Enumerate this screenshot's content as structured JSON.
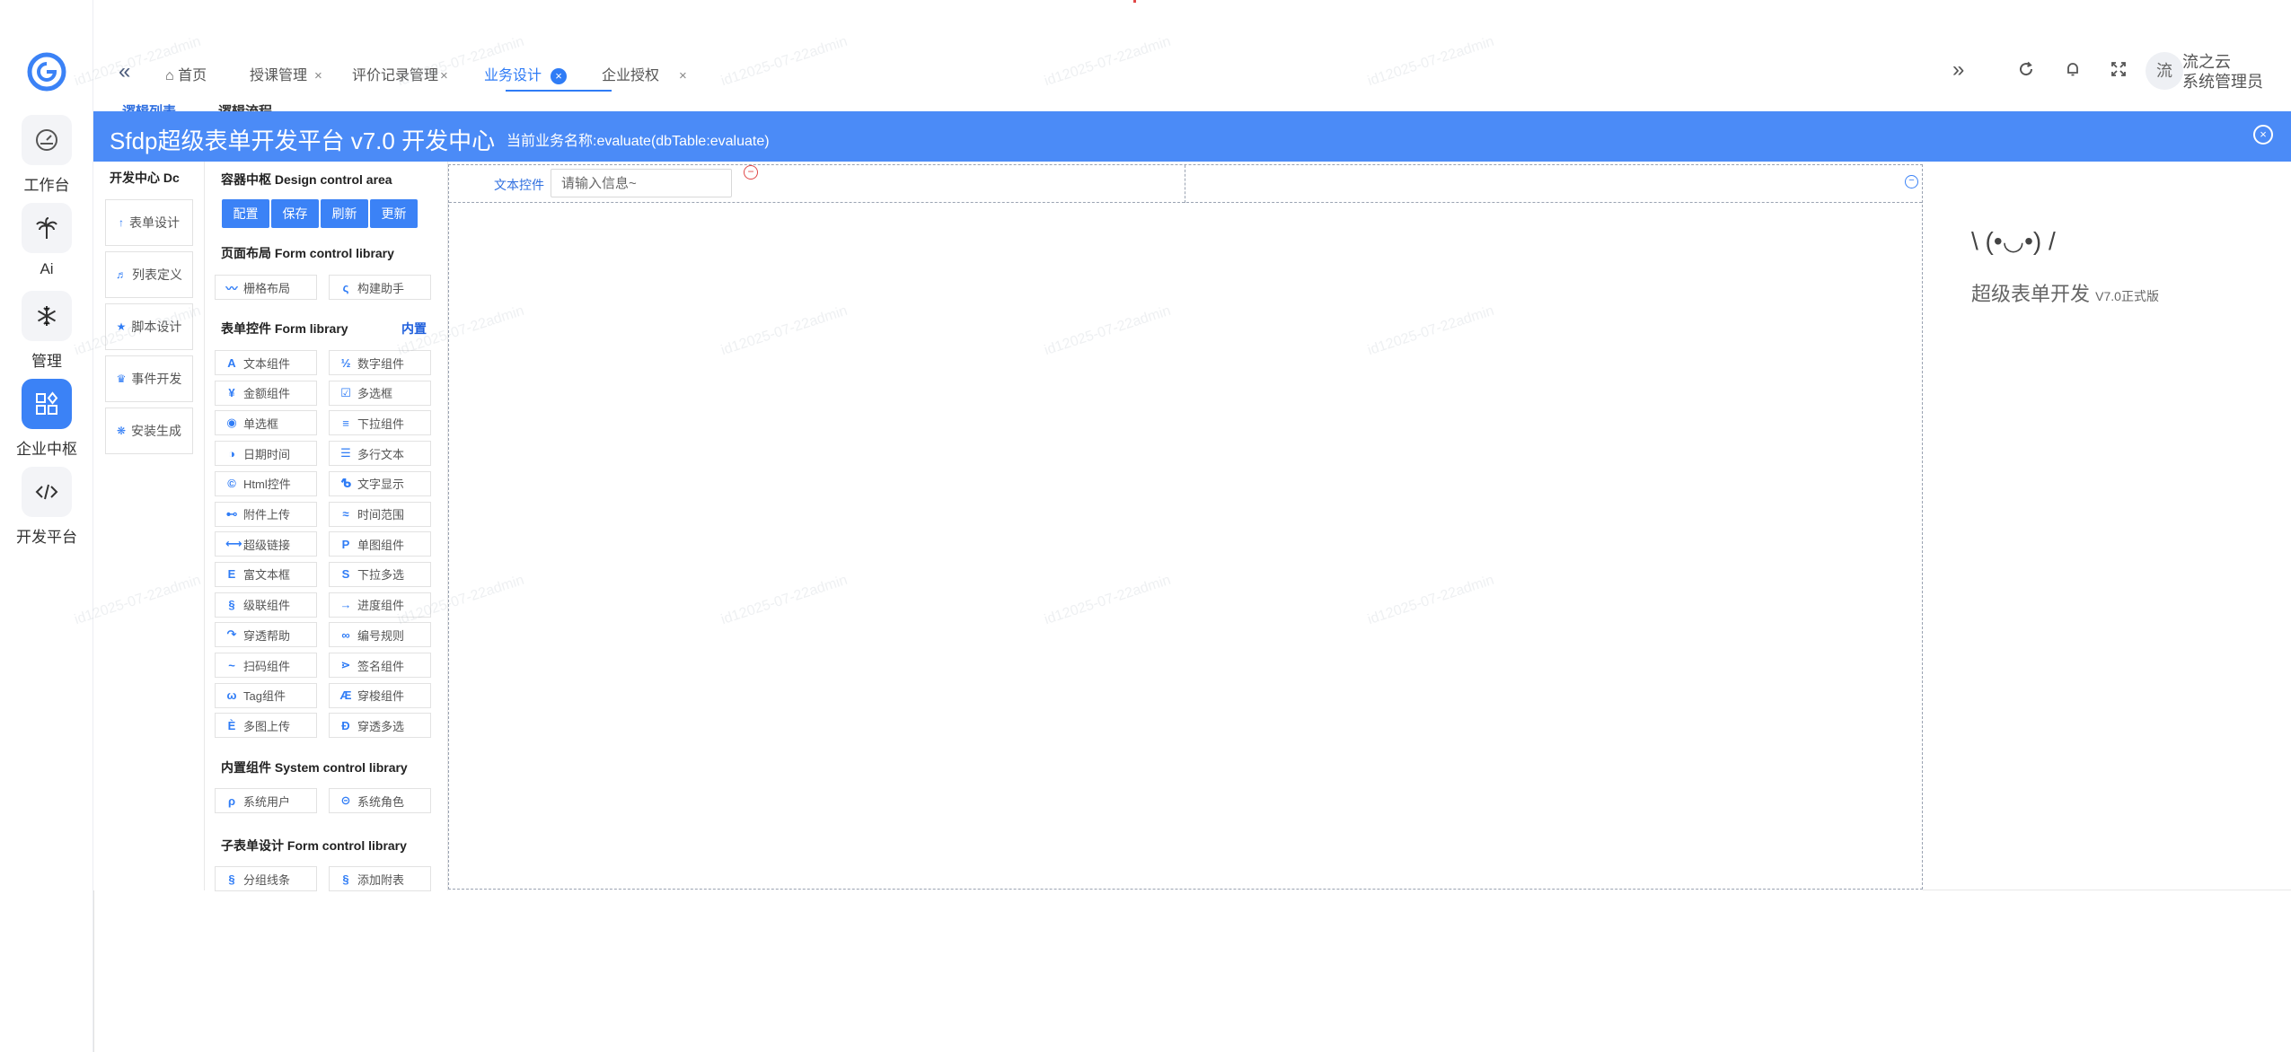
{
  "rail": {
    "items": [
      {
        "label": "工作台",
        "icon": "dashboard-icon"
      },
      {
        "label": "Ai",
        "icon": "palm-icon"
      },
      {
        "label": "管理",
        "icon": "snowflake-icon"
      },
      {
        "label": "企业中枢",
        "icon": "grid-apps-icon"
      },
      {
        "label": "开发平台",
        "icon": "code-icon"
      }
    ],
    "active_index": 3
  },
  "tabs": [
    {
      "label": "首页",
      "closable": false
    },
    {
      "label": "授课管理",
      "closable": true
    },
    {
      "label": "评价记录管理",
      "closable": true
    },
    {
      "label": "业务设计",
      "closable": true,
      "active": true
    },
    {
      "label": "企业授权",
      "closable": true
    }
  ],
  "topbar": {
    "close_glyph": "×",
    "more_glyph": "»",
    "avatar_text": "流",
    "user_line1": "流之云",
    "user_line2": "系统管理员"
  },
  "peek": {
    "left": "逻辑列表",
    "right": "逻辑流程"
  },
  "header": {
    "title": "Sfdp超级表单开发平台 v7.0 开发中心",
    "subtitle": "当前业务名称:evaluate(dbTable:evaluate)"
  },
  "dev_center": {
    "title": "开发中心 Dc",
    "items": [
      {
        "label": "表单设计",
        "glyph": "↑"
      },
      {
        "label": "列表定义",
        "glyph": "♬"
      },
      {
        "label": "脚本设计",
        "glyph": "★"
      },
      {
        "label": "事件开发",
        "glyph": "♛"
      },
      {
        "label": "安装生成",
        "glyph": "❋"
      }
    ]
  },
  "library": {
    "design_title": "容器中枢 Design control area",
    "actions": [
      "配置",
      "保存",
      "刷新",
      "更新"
    ],
    "layout_title": "页面布局 Form control library",
    "layout_items": [
      {
        "label": "栅格布局",
        "glyph": "〰"
      },
      {
        "label": "构建助手",
        "glyph": "ς"
      }
    ],
    "form_title": "表单控件 Form library",
    "builtin_label": "内置",
    "form_items": [
      {
        "label": "文本组件",
        "glyph": "A"
      },
      {
        "label": "数字组件",
        "glyph": "½"
      },
      {
        "label": "金额组件",
        "glyph": "¥"
      },
      {
        "label": "多选框",
        "glyph": "☑"
      },
      {
        "label": "单选框",
        "glyph": "◉"
      },
      {
        "label": "下拉组件",
        "glyph": "≡"
      },
      {
        "label": "日期时间",
        "glyph": "◑"
      },
      {
        "label": "多行文本",
        "glyph": "☰"
      },
      {
        "label": "Html控件",
        "glyph": "©"
      },
      {
        "label": "文字显示",
        "glyph": "ᕹ"
      },
      {
        "label": "附件上传",
        "glyph": "⊷"
      },
      {
        "label": "时间范围",
        "glyph": "≈"
      },
      {
        "label": "超级链接",
        "glyph": "⟷"
      },
      {
        "label": "单图组件",
        "glyph": "P"
      },
      {
        "label": "富文本框",
        "glyph": "E"
      },
      {
        "label": "下拉多选",
        "glyph": "S"
      },
      {
        "label": "级联组件",
        "glyph": "§"
      },
      {
        "label": "进度组件",
        "glyph": "→"
      },
      {
        "label": "穿透帮助",
        "glyph": "↷"
      },
      {
        "label": "编号规则",
        "glyph": "∞"
      },
      {
        "label": "扫码组件",
        "glyph": "~"
      },
      {
        "label": "签名组件",
        "glyph": "⋗"
      },
      {
        "label": "Tag组件",
        "glyph": "ω"
      },
      {
        "label": "穿梭组件",
        "glyph": "Æ"
      },
      {
        "label": "多图上传",
        "glyph": "È"
      },
      {
        "label": "穿透多选",
        "glyph": "Ð"
      }
    ],
    "system_title": "内置组件 System control library",
    "system_items": [
      {
        "label": "系统用户",
        "glyph": "ρ"
      },
      {
        "label": "系统角色",
        "glyph": "⊝"
      }
    ],
    "subform_title": "子表单设计 Form control library",
    "subform_items": [
      {
        "label": "分组线条",
        "glyph": "§"
      },
      {
        "label": "添加附表",
        "glyph": "§"
      }
    ]
  },
  "canvas": {
    "field_label": "文本控件",
    "field_placeholder": "请输入信息~"
  },
  "info": {
    "face": "\\ (•◡•) /",
    "title": "超级表单开发",
    "version": "V7.0正式版"
  },
  "watermark": "id12025-07-22admin",
  "colors": {
    "accent": "#3b82f6",
    "header": "#4b8bf7",
    "danger": "#e04848"
  }
}
